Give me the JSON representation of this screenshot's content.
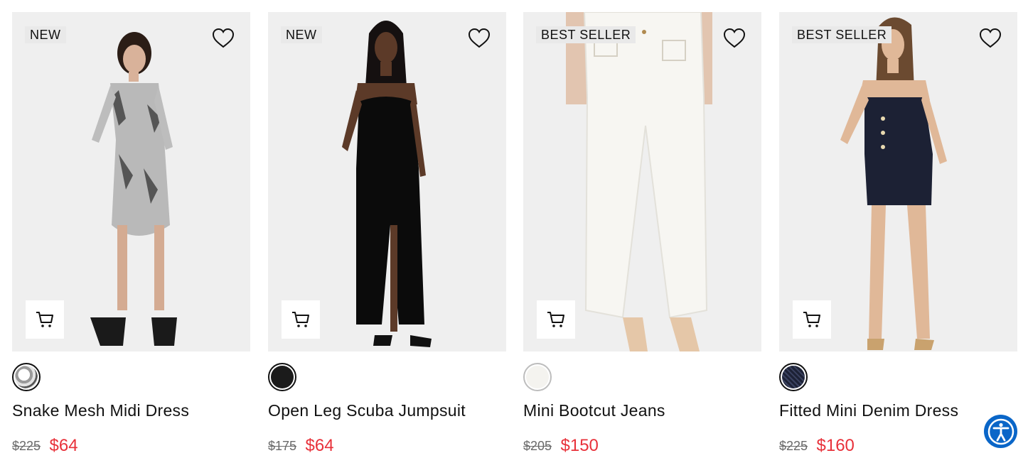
{
  "products": [
    {
      "badge": "NEW",
      "name": "Snake Mesh Midi Dress",
      "original_price": "$225",
      "sale_price": "$64",
      "swatch_color": "#cfcfcf",
      "image_icon": "model-photo-snake-dress"
    },
    {
      "badge": "NEW",
      "name": "Open Leg Scuba Jumpsuit",
      "original_price": "$175",
      "sale_price": "$64",
      "swatch_color": "#1b1b1b",
      "image_icon": "model-photo-black-jumpsuit"
    },
    {
      "badge": "BEST SELLER",
      "name": "Mini Bootcut Jeans",
      "original_price": "$205",
      "sale_price": "$150",
      "swatch_color": "#f4f3ef",
      "image_icon": "model-photo-white-jeans"
    },
    {
      "badge": "BEST SELLER",
      "name": "Fitted Mini Denim Dress",
      "original_price": "$225",
      "sale_price": "$160",
      "swatch_color": "#1d2236",
      "image_icon": "model-photo-denim-dress"
    }
  ],
  "colors": {
    "sale": "#e8313a",
    "accessibility_button": "#0a66c8"
  },
  "icons": {
    "favorite": "heart-outline-icon",
    "cart": "shopping-cart-icon",
    "accessibility": "accessibility-person-icon"
  }
}
